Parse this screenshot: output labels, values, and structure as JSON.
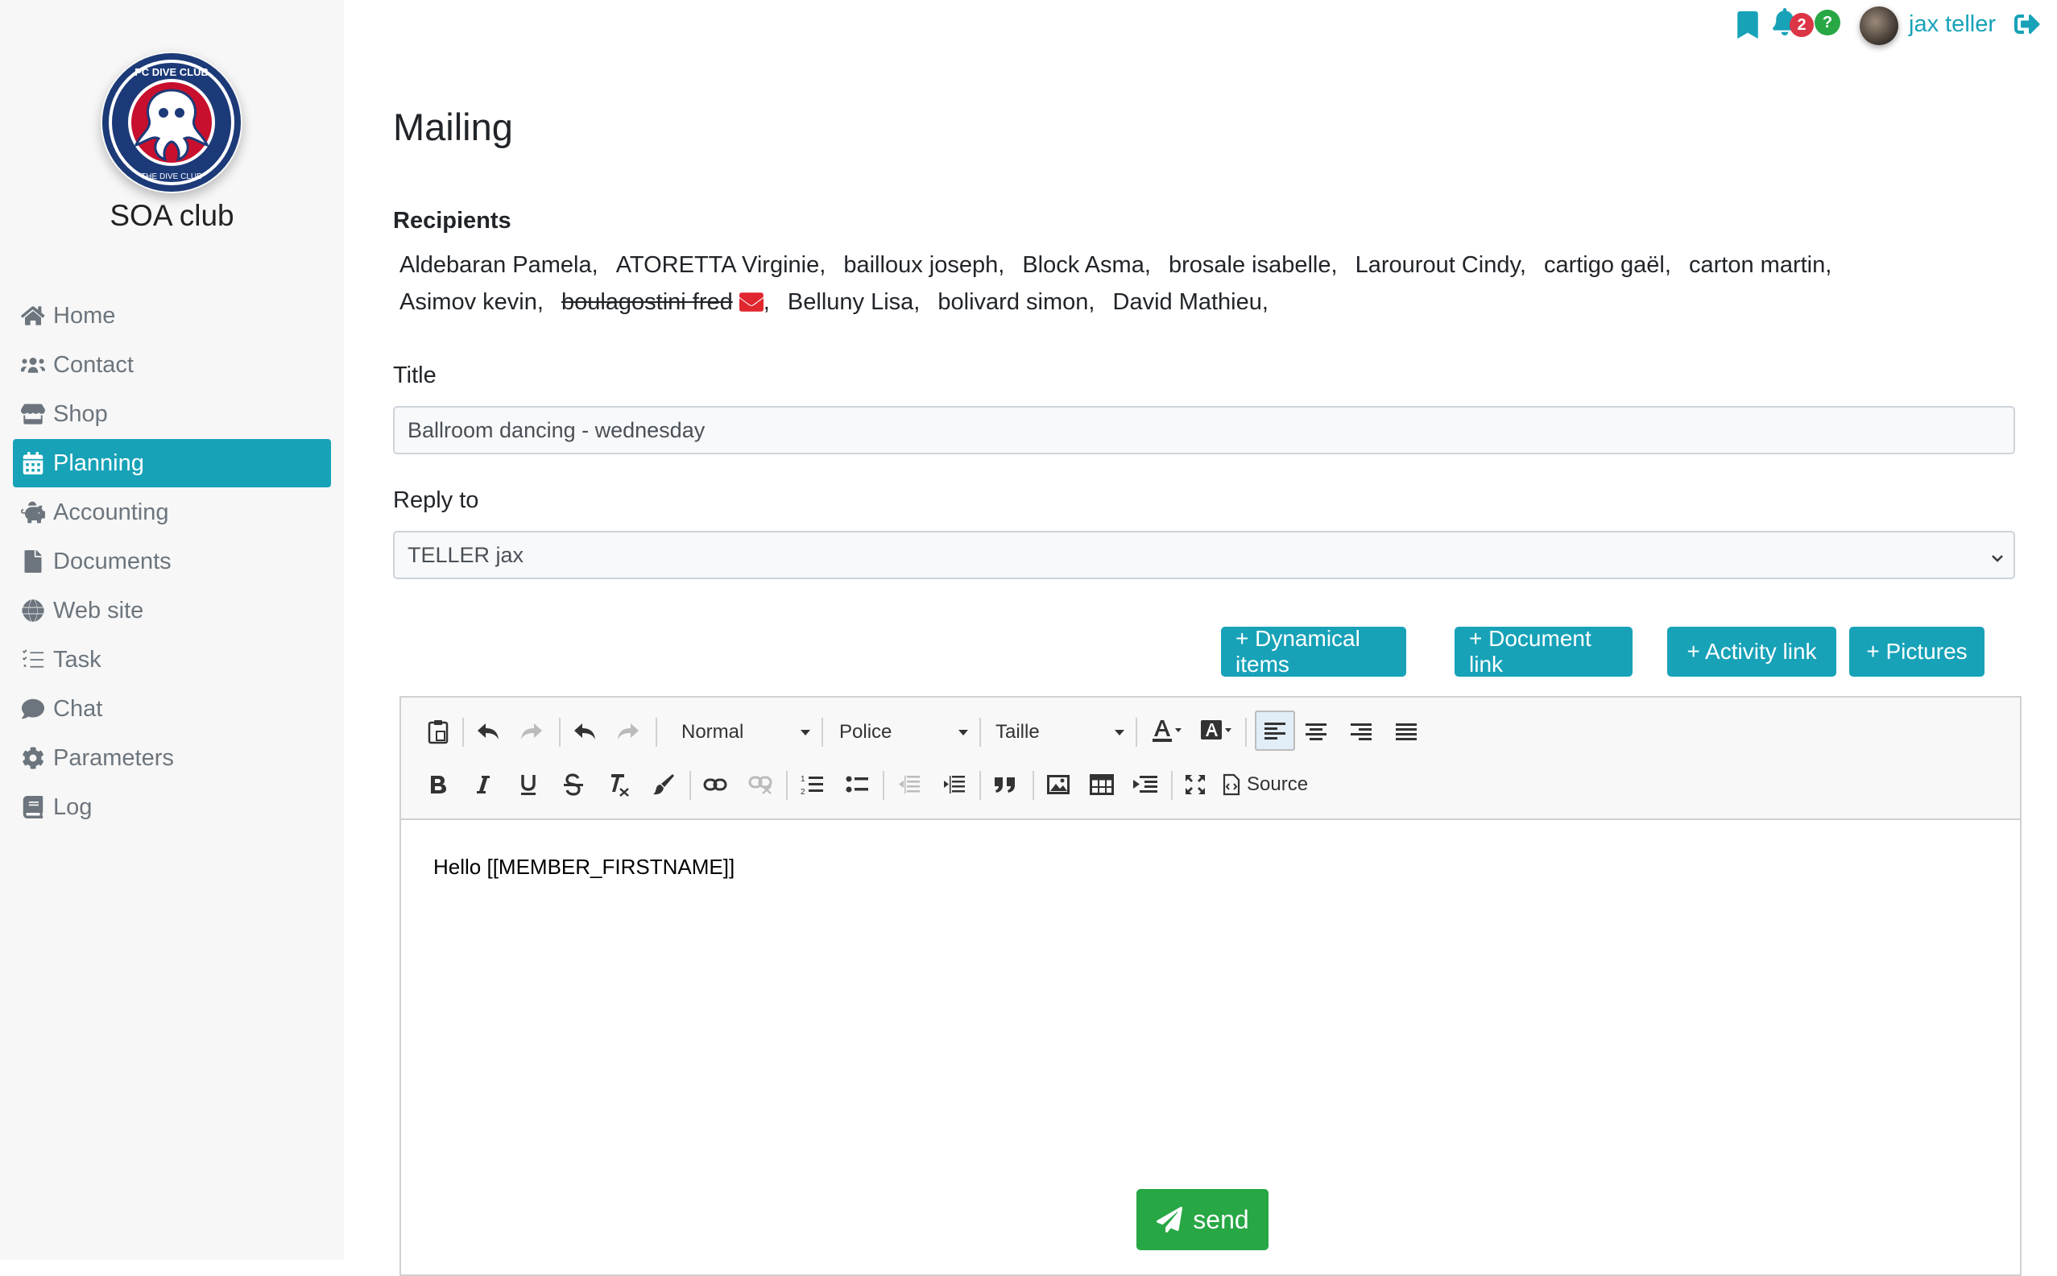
{
  "sidebar": {
    "club_name": "SOA club",
    "logo_text": "PC DIVE CLUB · THE DIVE CLUB THAT DIVES",
    "items": [
      {
        "label": "Home",
        "icon": "home-icon"
      },
      {
        "label": "Contact",
        "icon": "users-icon"
      },
      {
        "label": "Shop",
        "icon": "store-icon"
      },
      {
        "label": "Planning",
        "icon": "calendar-icon",
        "active": true
      },
      {
        "label": "Accounting",
        "icon": "piggy-bank-icon"
      },
      {
        "label": "Documents",
        "icon": "file-icon"
      },
      {
        "label": "Web site",
        "icon": "globe-icon"
      },
      {
        "label": "Task",
        "icon": "tasks-icon"
      },
      {
        "label": "Chat",
        "icon": "comment-icon"
      },
      {
        "label": "Parameters",
        "icon": "gear-icon"
      },
      {
        "label": "Log",
        "icon": "book-icon"
      }
    ]
  },
  "topbar": {
    "notification_count": "2",
    "help_badge": "?",
    "username": "jax teller"
  },
  "page": {
    "title": "Mailing",
    "recipients_heading": "Recipients",
    "recipients": [
      {
        "name": "Aldebaran Pamela",
        "sep": ","
      },
      {
        "name": "ATORETTA Virginie",
        "sep": ","
      },
      {
        "name": "bailloux joseph",
        "sep": ","
      },
      {
        "name": "Block Asma",
        "sep": ","
      },
      {
        "name": "brosale isabelle",
        "sep": ","
      },
      {
        "name": "Larourout Cindy",
        "sep": ","
      },
      {
        "name": "cartigo gaël",
        "sep": ","
      },
      {
        "name": "carton martin",
        "sep": ","
      },
      {
        "name": "Asimov kevin",
        "sep": ","
      },
      {
        "name": "boulagostini fred",
        "sep": ",",
        "struck": true
      },
      {
        "name": "Belluny Lisa",
        "sep": ","
      },
      {
        "name": "bolivard simon",
        "sep": ","
      },
      {
        "name": "David Mathieu",
        "sep": ","
      }
    ],
    "title_label": "Title",
    "title_value": "Ballroom dancing - wednesday",
    "reply_label": "Reply to",
    "reply_value": "TELLER jax",
    "buttons": {
      "dynamical": "+ Dynamical items",
      "document": "+ Document link",
      "activity": "+ Activity link",
      "pictures": "+ Pictures"
    },
    "editor": {
      "format_combo": "Normal",
      "font_combo": "Police",
      "size_combo": "Taille",
      "source_label": "Source",
      "content": "Hello [[MEMBER_FIRSTNAME]]"
    },
    "send_label": "send"
  },
  "colors": {
    "accent": "#17a2b8",
    "success": "#28a745",
    "danger": "#dc3545",
    "sidebar_bg": "#f7f7f7"
  }
}
